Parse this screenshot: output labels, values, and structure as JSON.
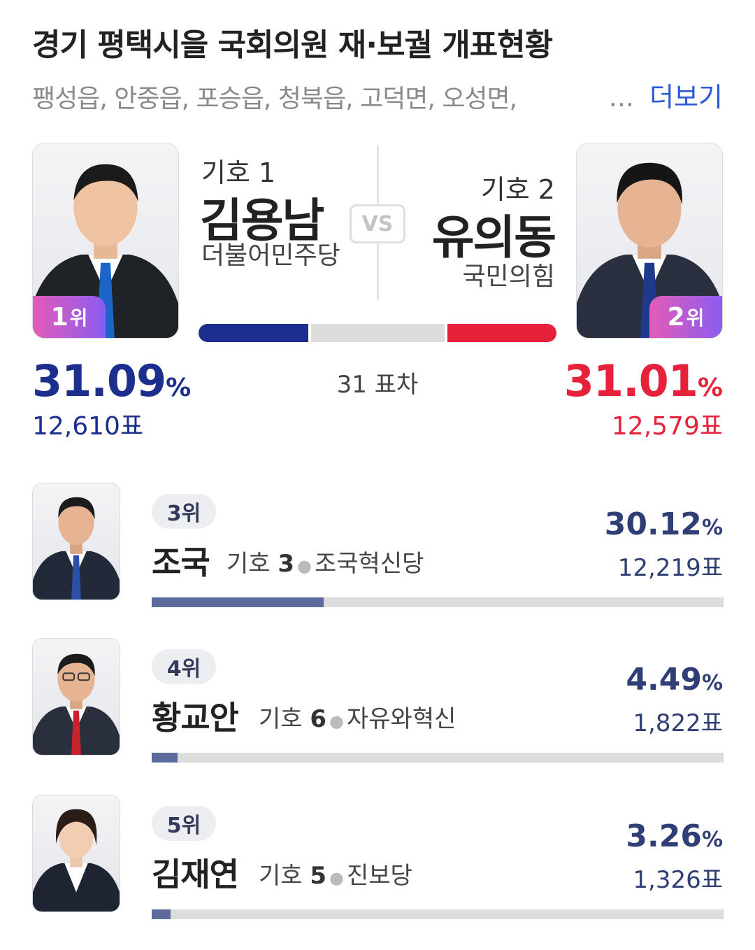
{
  "header": {
    "title": "경기 평택시을 국회의원 재·보궐 개표현황",
    "regions": "팽성읍, 안중읍, 포승읍, 청북읍, 고덕면, 오성면,",
    "ellipsis": "...",
    "more_label": "더보기"
  },
  "top": {
    "vs_label": "VS",
    "margin_label": "31 표차",
    "bar_fractions": {
      "first": 0.3109,
      "second": 0.3101
    },
    "first": {
      "number_label": "기호 1",
      "name": "김용남",
      "party": "더불어민주당",
      "rank_num": "1",
      "rank_unit": "위",
      "percent": "31.09",
      "percent_sym": "%",
      "votes": "12,610표",
      "color": "#1d2f8e",
      "tie_color": "#1c64c8"
    },
    "second": {
      "number_label": "기호 2",
      "name": "유의동",
      "party": "국민의힘",
      "rank_num": "2",
      "rank_unit": "위",
      "percent": "31.01",
      "percent_sym": "%",
      "votes": "12,579표",
      "color": "#e5223a",
      "tie_color": "#1e3a8a"
    }
  },
  "others": [
    {
      "rank": "3위",
      "name": "조국",
      "num_prefix": "기호",
      "num": "3",
      "party": "조국혁신당",
      "percent": "30.12",
      "percent_sym": "%",
      "votes": "12,219표",
      "fraction": 0.3012,
      "tie_color": "#2c4fa8"
    },
    {
      "rank": "4위",
      "name": "황교안",
      "num_prefix": "기호",
      "num": "6",
      "party": "자유와혁신",
      "percent": "4.49",
      "percent_sym": "%",
      "votes": "1,822표",
      "fraction": 0.0449,
      "tie_color": "#c8232d"
    },
    {
      "rank": "5위",
      "name": "김재연",
      "num_prefix": "기호",
      "num": "5",
      "party": "진보당",
      "percent": "3.26",
      "percent_sym": "%",
      "votes": "1,326표",
      "fraction": 0.0326,
      "tie_color": "#ffffff"
    }
  ],
  "colors": {
    "link": "#2a5ad8",
    "bar_fill": "#5e6a9c",
    "bar_track": "#dcdcdc"
  }
}
